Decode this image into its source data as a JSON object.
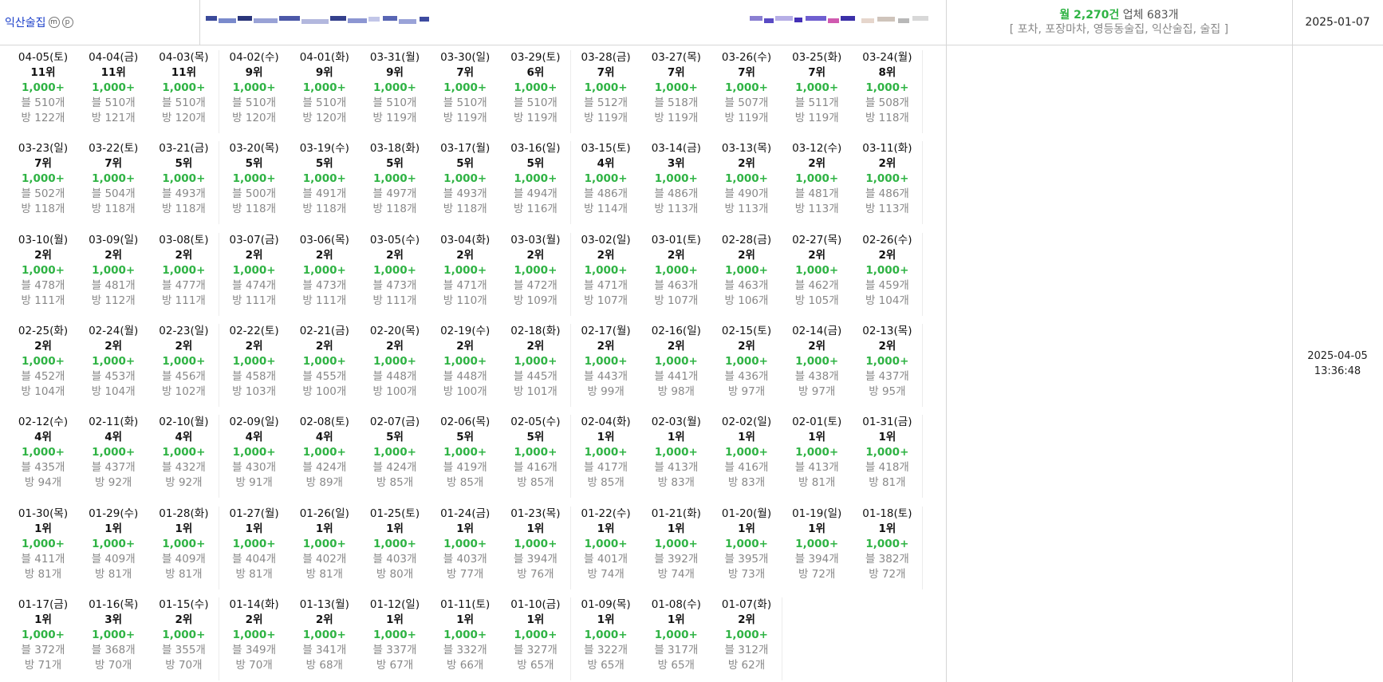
{
  "keyword": {
    "label": "익산술집",
    "badges": [
      "m",
      "p"
    ]
  },
  "summary": {
    "monthly": "월 2,270건",
    "companies": "업체 683개",
    "tags": "[ 포차, 포장마차, 영등동술집, 익산술집, 술집 ]"
  },
  "created_date": "2025-01-07",
  "updated": {
    "date": "2025-04-05",
    "time": "13:36:48"
  },
  "colors": {
    "accent_green": "#2fb344",
    "link_blue": "#1a3ec9",
    "muted_gray": "#888888"
  },
  "days": [
    {
      "date": "04-05(토)",
      "rank": "11위",
      "volume": "1,000+",
      "blog": "블 510개",
      "cafe": "방 122개"
    },
    {
      "date": "04-04(금)",
      "rank": "11위",
      "volume": "1,000+",
      "blog": "블 510개",
      "cafe": "방 121개"
    },
    {
      "date": "04-03(목)",
      "rank": "11위",
      "volume": "1,000+",
      "blog": "블 510개",
      "cafe": "방 120개"
    },
    {
      "date": "04-02(수)",
      "rank": "9위",
      "volume": "1,000+",
      "blog": "블 510개",
      "cafe": "방 120개"
    },
    {
      "date": "04-01(화)",
      "rank": "9위",
      "volume": "1,000+",
      "blog": "블 510개",
      "cafe": "방 120개"
    },
    {
      "date": "03-31(월)",
      "rank": "9위",
      "volume": "1,000+",
      "blog": "블 510개",
      "cafe": "방 119개"
    },
    {
      "date": "03-30(일)",
      "rank": "7위",
      "volume": "1,000+",
      "blog": "블 510개",
      "cafe": "방 119개"
    },
    {
      "date": "03-29(토)",
      "rank": "6위",
      "volume": "1,000+",
      "blog": "블 510개",
      "cafe": "방 119개"
    },
    {
      "date": "03-28(금)",
      "rank": "7위",
      "volume": "1,000+",
      "blog": "블 512개",
      "cafe": "방 119개"
    },
    {
      "date": "03-27(목)",
      "rank": "7위",
      "volume": "1,000+",
      "blog": "블 518개",
      "cafe": "방 119개"
    },
    {
      "date": "03-26(수)",
      "rank": "7위",
      "volume": "1,000+",
      "blog": "블 507개",
      "cafe": "방 119개"
    },
    {
      "date": "03-25(화)",
      "rank": "7위",
      "volume": "1,000+",
      "blog": "블 511개",
      "cafe": "방 119개"
    },
    {
      "date": "03-24(월)",
      "rank": "8위",
      "volume": "1,000+",
      "blog": "블 508개",
      "cafe": "방 118개"
    },
    {
      "date": "03-23(일)",
      "rank": "7위",
      "volume": "1,000+",
      "blog": "블 502개",
      "cafe": "방 118개"
    },
    {
      "date": "03-22(토)",
      "rank": "7위",
      "volume": "1,000+",
      "blog": "블 504개",
      "cafe": "방 118개"
    },
    {
      "date": "03-21(금)",
      "rank": "5위",
      "volume": "1,000+",
      "blog": "블 493개",
      "cafe": "방 118개"
    },
    {
      "date": "03-20(목)",
      "rank": "5위",
      "volume": "1,000+",
      "blog": "블 500개",
      "cafe": "방 118개"
    },
    {
      "date": "03-19(수)",
      "rank": "5위",
      "volume": "1,000+",
      "blog": "블 491개",
      "cafe": "방 118개"
    },
    {
      "date": "03-18(화)",
      "rank": "5위",
      "volume": "1,000+",
      "blog": "블 497개",
      "cafe": "방 118개"
    },
    {
      "date": "03-17(월)",
      "rank": "5위",
      "volume": "1,000+",
      "blog": "블 493개",
      "cafe": "방 118개"
    },
    {
      "date": "03-16(일)",
      "rank": "5위",
      "volume": "1,000+",
      "blog": "블 494개",
      "cafe": "방 116개"
    },
    {
      "date": "03-15(토)",
      "rank": "4위",
      "volume": "1,000+",
      "blog": "블 486개",
      "cafe": "방 114개"
    },
    {
      "date": "03-14(금)",
      "rank": "3위",
      "volume": "1,000+",
      "blog": "블 486개",
      "cafe": "방 113개"
    },
    {
      "date": "03-13(목)",
      "rank": "2위",
      "volume": "1,000+",
      "blog": "블 490개",
      "cafe": "방 113개"
    },
    {
      "date": "03-12(수)",
      "rank": "2위",
      "volume": "1,000+",
      "blog": "블 481개",
      "cafe": "방 113개"
    },
    {
      "date": "03-11(화)",
      "rank": "2위",
      "volume": "1,000+",
      "blog": "블 486개",
      "cafe": "방 113개"
    },
    {
      "date": "03-10(월)",
      "rank": "2위",
      "volume": "1,000+",
      "blog": "블 478개",
      "cafe": "방 111개"
    },
    {
      "date": "03-09(일)",
      "rank": "2위",
      "volume": "1,000+",
      "blog": "블 481개",
      "cafe": "방 112개"
    },
    {
      "date": "03-08(토)",
      "rank": "2위",
      "volume": "1,000+",
      "blog": "블 477개",
      "cafe": "방 111개"
    },
    {
      "date": "03-07(금)",
      "rank": "2위",
      "volume": "1,000+",
      "blog": "블 474개",
      "cafe": "방 111개"
    },
    {
      "date": "03-06(목)",
      "rank": "2위",
      "volume": "1,000+",
      "blog": "블 473개",
      "cafe": "방 111개"
    },
    {
      "date": "03-05(수)",
      "rank": "2위",
      "volume": "1,000+",
      "blog": "블 473개",
      "cafe": "방 111개"
    },
    {
      "date": "03-04(화)",
      "rank": "2위",
      "volume": "1,000+",
      "blog": "블 471개",
      "cafe": "방 110개"
    },
    {
      "date": "03-03(월)",
      "rank": "2위",
      "volume": "1,000+",
      "blog": "블 472개",
      "cafe": "방 109개"
    },
    {
      "date": "03-02(일)",
      "rank": "2위",
      "volume": "1,000+",
      "blog": "블 471개",
      "cafe": "방 107개"
    },
    {
      "date": "03-01(토)",
      "rank": "2위",
      "volume": "1,000+",
      "blog": "블 463개",
      "cafe": "방 107개"
    },
    {
      "date": "02-28(금)",
      "rank": "2위",
      "volume": "1,000+",
      "blog": "블 463개",
      "cafe": "방 106개"
    },
    {
      "date": "02-27(목)",
      "rank": "2위",
      "volume": "1,000+",
      "blog": "블 462개",
      "cafe": "방 105개"
    },
    {
      "date": "02-26(수)",
      "rank": "2위",
      "volume": "1,000+",
      "blog": "블 459개",
      "cafe": "방 104개"
    },
    {
      "date": "02-25(화)",
      "rank": "2위",
      "volume": "1,000+",
      "blog": "블 452개",
      "cafe": "방 104개"
    },
    {
      "date": "02-24(월)",
      "rank": "2위",
      "volume": "1,000+",
      "blog": "블 453개",
      "cafe": "방 104개"
    },
    {
      "date": "02-23(일)",
      "rank": "2위",
      "volume": "1,000+",
      "blog": "블 456개",
      "cafe": "방 102개"
    },
    {
      "date": "02-22(토)",
      "rank": "2위",
      "volume": "1,000+",
      "blog": "블 458개",
      "cafe": "방 103개"
    },
    {
      "date": "02-21(금)",
      "rank": "2위",
      "volume": "1,000+",
      "blog": "블 455개",
      "cafe": "방 100개"
    },
    {
      "date": "02-20(목)",
      "rank": "2위",
      "volume": "1,000+",
      "blog": "블 448개",
      "cafe": "방 100개"
    },
    {
      "date": "02-19(수)",
      "rank": "2위",
      "volume": "1,000+",
      "blog": "블 448개",
      "cafe": "방 100개"
    },
    {
      "date": "02-18(화)",
      "rank": "2위",
      "volume": "1,000+",
      "blog": "블 445개",
      "cafe": "방 101개"
    },
    {
      "date": "02-17(월)",
      "rank": "2위",
      "volume": "1,000+",
      "blog": "블 443개",
      "cafe": "방 99개"
    },
    {
      "date": "02-16(일)",
      "rank": "2위",
      "volume": "1,000+",
      "blog": "블 441개",
      "cafe": "방 98개"
    },
    {
      "date": "02-15(토)",
      "rank": "2위",
      "volume": "1,000+",
      "blog": "블 436개",
      "cafe": "방 97개"
    },
    {
      "date": "02-14(금)",
      "rank": "2위",
      "volume": "1,000+",
      "blog": "블 438개",
      "cafe": "방 97개"
    },
    {
      "date": "02-13(목)",
      "rank": "2위",
      "volume": "1,000+",
      "blog": "블 437개",
      "cafe": "방 95개"
    },
    {
      "date": "02-12(수)",
      "rank": "4위",
      "volume": "1,000+",
      "blog": "블 435개",
      "cafe": "방 94개"
    },
    {
      "date": "02-11(화)",
      "rank": "4위",
      "volume": "1,000+",
      "blog": "블 437개",
      "cafe": "방 92개"
    },
    {
      "date": "02-10(월)",
      "rank": "4위",
      "volume": "1,000+",
      "blog": "블 432개",
      "cafe": "방 92개"
    },
    {
      "date": "02-09(일)",
      "rank": "4위",
      "volume": "1,000+",
      "blog": "블 430개",
      "cafe": "방 91개"
    },
    {
      "date": "02-08(토)",
      "rank": "4위",
      "volume": "1,000+",
      "blog": "블 424개",
      "cafe": "방 89개"
    },
    {
      "date": "02-07(금)",
      "rank": "5위",
      "volume": "1,000+",
      "blog": "블 424개",
      "cafe": "방 85개"
    },
    {
      "date": "02-06(목)",
      "rank": "5위",
      "volume": "1,000+",
      "blog": "블 419개",
      "cafe": "방 85개"
    },
    {
      "date": "02-05(수)",
      "rank": "5위",
      "volume": "1,000+",
      "blog": "블 416개",
      "cafe": "방 85개"
    },
    {
      "date": "02-04(화)",
      "rank": "1위",
      "volume": "1,000+",
      "blog": "블 417개",
      "cafe": "방 85개"
    },
    {
      "date": "02-03(월)",
      "rank": "1위",
      "volume": "1,000+",
      "blog": "블 413개",
      "cafe": "방 83개"
    },
    {
      "date": "02-02(일)",
      "rank": "1위",
      "volume": "1,000+",
      "blog": "블 416개",
      "cafe": "방 83개"
    },
    {
      "date": "02-01(토)",
      "rank": "1위",
      "volume": "1,000+",
      "blog": "블 413개",
      "cafe": "방 81개"
    },
    {
      "date": "01-31(금)",
      "rank": "1위",
      "volume": "1,000+",
      "blog": "블 418개",
      "cafe": "방 81개"
    },
    {
      "date": "01-30(목)",
      "rank": "1위",
      "volume": "1,000+",
      "blog": "블 411개",
      "cafe": "방 81개"
    },
    {
      "date": "01-29(수)",
      "rank": "1위",
      "volume": "1,000+",
      "blog": "블 409개",
      "cafe": "방 81개"
    },
    {
      "date": "01-28(화)",
      "rank": "1위",
      "volume": "1,000+",
      "blog": "블 409개",
      "cafe": "방 81개"
    },
    {
      "date": "01-27(월)",
      "rank": "1위",
      "volume": "1,000+",
      "blog": "블 404개",
      "cafe": "방 81개"
    },
    {
      "date": "01-26(일)",
      "rank": "1위",
      "volume": "1,000+",
      "blog": "블 402개",
      "cafe": "방 81개"
    },
    {
      "date": "01-25(토)",
      "rank": "1위",
      "volume": "1,000+",
      "blog": "블 403개",
      "cafe": "방 80개"
    },
    {
      "date": "01-24(금)",
      "rank": "1위",
      "volume": "1,000+",
      "blog": "블 403개",
      "cafe": "방 77개"
    },
    {
      "date": "01-23(목)",
      "rank": "1위",
      "volume": "1,000+",
      "blog": "블 394개",
      "cafe": "방 76개"
    },
    {
      "date": "01-22(수)",
      "rank": "1위",
      "volume": "1,000+",
      "blog": "블 401개",
      "cafe": "방 74개"
    },
    {
      "date": "01-21(화)",
      "rank": "1위",
      "volume": "1,000+",
      "blog": "블 392개",
      "cafe": "방 74개"
    },
    {
      "date": "01-20(월)",
      "rank": "1위",
      "volume": "1,000+",
      "blog": "블 395개",
      "cafe": "방 73개"
    },
    {
      "date": "01-19(일)",
      "rank": "1위",
      "volume": "1,000+",
      "blog": "블 394개",
      "cafe": "방 72개"
    },
    {
      "date": "01-18(토)",
      "rank": "1위",
      "volume": "1,000+",
      "blog": "블 382개",
      "cafe": "방 72개"
    },
    {
      "date": "01-17(금)",
      "rank": "1위",
      "volume": "1,000+",
      "blog": "블 372개",
      "cafe": "방 71개"
    },
    {
      "date": "01-16(목)",
      "rank": "3위",
      "volume": "1,000+",
      "blog": "블 368개",
      "cafe": "방 70개"
    },
    {
      "date": "01-15(수)",
      "rank": "2위",
      "volume": "1,000+",
      "blog": "블 355개",
      "cafe": "방 70개"
    },
    {
      "date": "01-14(화)",
      "rank": "2위",
      "volume": "1,000+",
      "blog": "블 349개",
      "cafe": "방 70개"
    },
    {
      "date": "01-13(월)",
      "rank": "2위",
      "volume": "1,000+",
      "blog": "블 341개",
      "cafe": "방 68개"
    },
    {
      "date": "01-12(일)",
      "rank": "1위",
      "volume": "1,000+",
      "blog": "블 337개",
      "cafe": "방 67개"
    },
    {
      "date": "01-11(토)",
      "rank": "1위",
      "volume": "1,000+",
      "blog": "블 332개",
      "cafe": "방 66개"
    },
    {
      "date": "01-10(금)",
      "rank": "1위",
      "volume": "1,000+",
      "blog": "블 327개",
      "cafe": "방 65개"
    },
    {
      "date": "01-09(목)",
      "rank": "1위",
      "volume": "1,000+",
      "blog": "블 322개",
      "cafe": "방 65개"
    },
    {
      "date": "01-08(수)",
      "rank": "1위",
      "volume": "1,000+",
      "blog": "블 317개",
      "cafe": "방 65개"
    },
    {
      "date": "01-07(화)",
      "rank": "2위",
      "volume": "1,000+",
      "blog": "블 312개",
      "cafe": "방 62개"
    }
  ]
}
